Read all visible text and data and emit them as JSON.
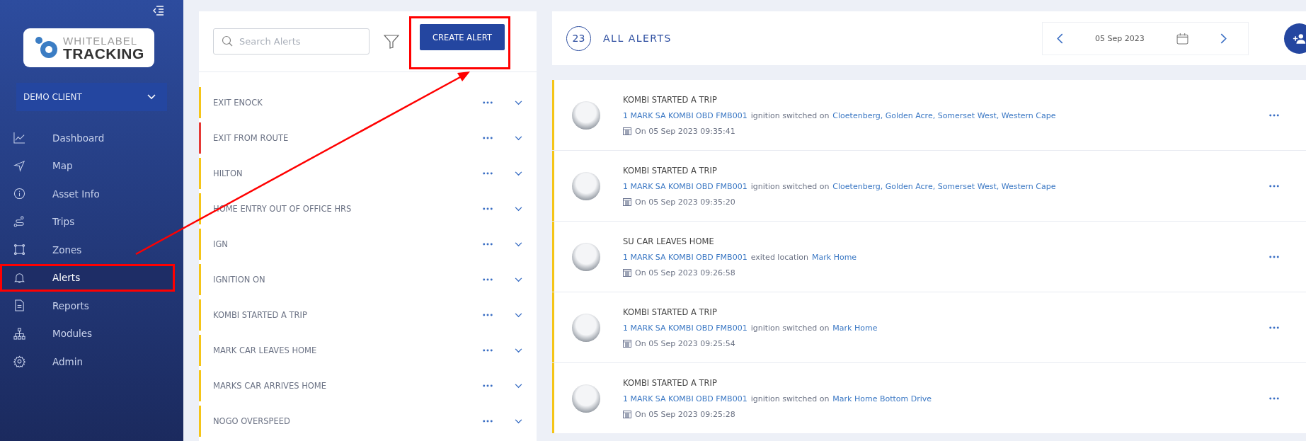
{
  "sidebar": {
    "logo": {
      "top": "WHITELABEL",
      "bottom": "TRACKING"
    },
    "client": "DEMO CLIENT",
    "nav": [
      {
        "label": "Dashboard",
        "selected": false,
        "annotated": false
      },
      {
        "label": "Map",
        "selected": false,
        "annotated": false
      },
      {
        "label": "Asset Info",
        "selected": false,
        "annotated": false
      },
      {
        "label": "Trips",
        "selected": false,
        "annotated": false
      },
      {
        "label": "Zones",
        "selected": false,
        "annotated": false
      },
      {
        "label": "Alerts",
        "selected": true,
        "annotated": true
      },
      {
        "label": "Reports",
        "selected": false,
        "annotated": false
      },
      {
        "label": "Modules",
        "selected": false,
        "annotated": false
      },
      {
        "label": "Admin",
        "selected": false,
        "annotated": false
      }
    ]
  },
  "alert_list": {
    "search": {
      "placeholder": "Search Alerts"
    },
    "create_button": {
      "label": "CREATE ALERT",
      "annotated": true
    },
    "items": [
      {
        "name": "EXIT ENOCK",
        "color": "#f5c518"
      },
      {
        "name": "EXIT FROM ROUTE",
        "color": "#e53935"
      },
      {
        "name": "HILTON",
        "color": "#f5c518"
      },
      {
        "name": "HOME ENTRY OUT OF OFFICE HRS",
        "color": "#f5c518"
      },
      {
        "name": "IGN",
        "color": "#f5c518"
      },
      {
        "name": "IGNITION ON",
        "color": "#f5c518"
      },
      {
        "name": "KOMBI STARTED A TRIP",
        "color": "#f5c518"
      },
      {
        "name": "MARK CAR LEAVES HOME",
        "color": "#f5c518"
      },
      {
        "name": "MARKS CAR ARRIVES HOME",
        "color": "#f5c518"
      },
      {
        "name": "NOGO OVERSPEED",
        "color": "#f5c518"
      }
    ]
  },
  "events_header": {
    "count": "23",
    "title": "ALL ALERTS",
    "date": "05 Sep 2023"
  },
  "events": [
    {
      "title": "KOMBI STARTED A TRIP",
      "asset": "1 MARK SA KOMBI OBD FMB001",
      "action": "ignition switched on",
      "location": "Cloetenberg, Golden Acre, Somerset West, Western Cape",
      "time": "On 05 Sep 2023 09:35:41"
    },
    {
      "title": "KOMBI STARTED A TRIP",
      "asset": "1 MARK SA KOMBI OBD FMB001",
      "action": "ignition switched on",
      "location": "Cloetenberg, Golden Acre, Somerset West, Western Cape",
      "time": "On 05 Sep 2023 09:35:20"
    },
    {
      "title": "SU CAR LEAVES HOME",
      "asset": "1 MARK SA KOMBI OBD FMB001",
      "action": "exited location",
      "location": "Mark Home",
      "time": "On 05 Sep 2023 09:26:58"
    },
    {
      "title": "KOMBI STARTED A TRIP",
      "asset": "1 MARK SA KOMBI OBD FMB001",
      "action": "ignition switched on",
      "location": "Mark Home",
      "time": "On 05 Sep 2023 09:25:54"
    },
    {
      "title": "KOMBI STARTED A TRIP",
      "asset": "1 MARK SA KOMBI OBD FMB001",
      "action": "ignition switched on",
      "location": "Mark Home Bottom Drive",
      "time": "On 05 Sep 2023 09:25:28"
    }
  ]
}
